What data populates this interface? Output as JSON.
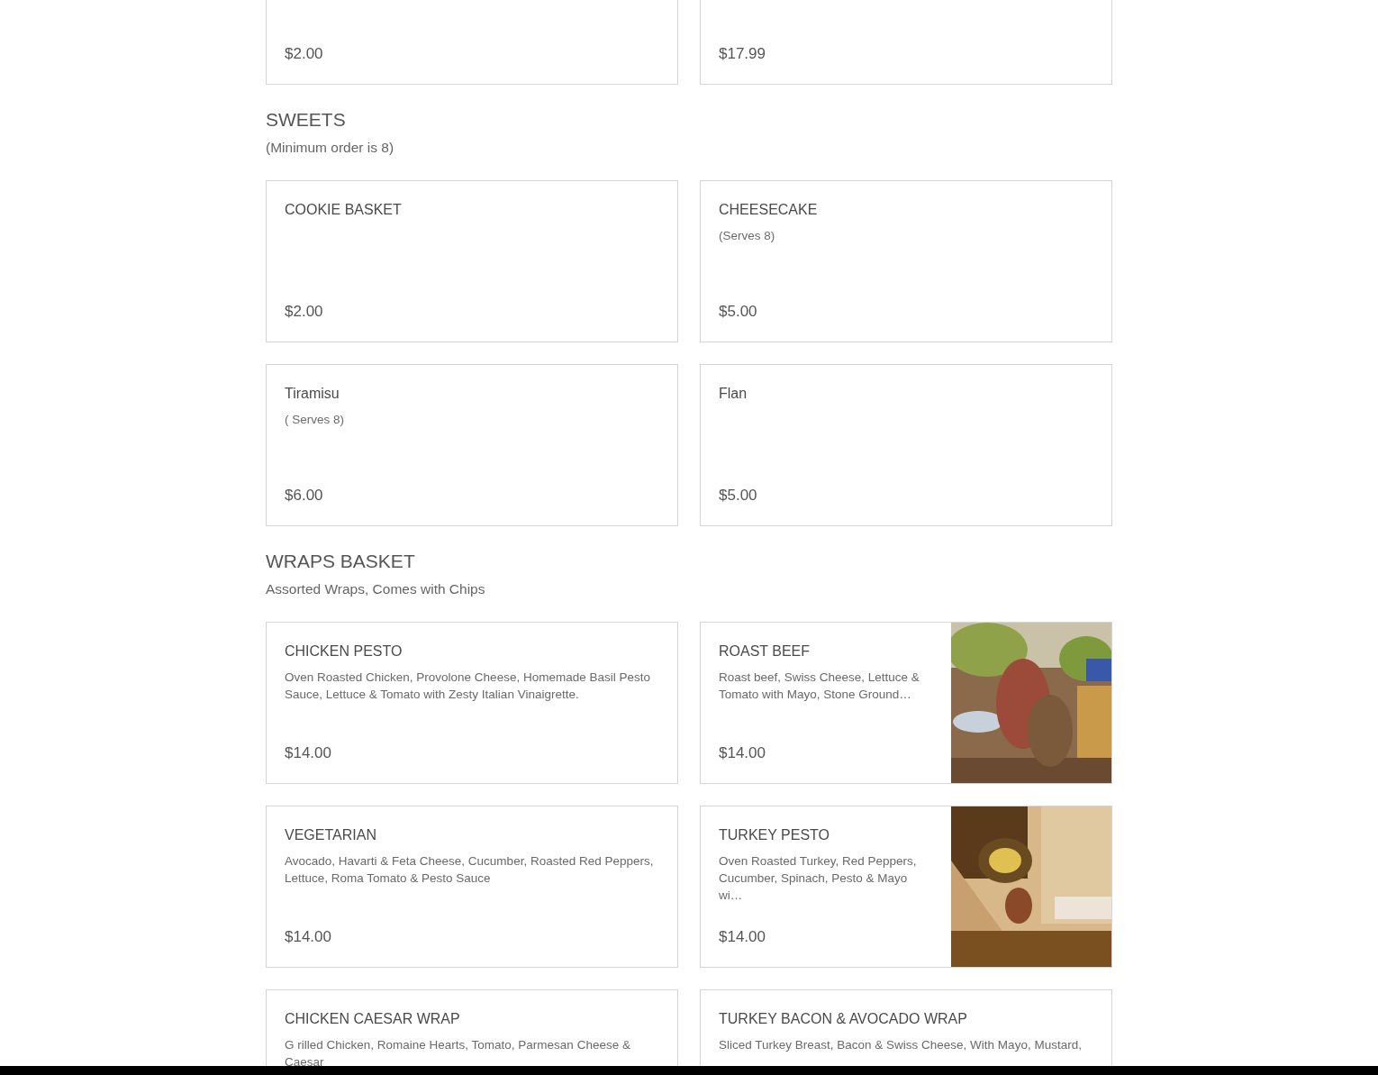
{
  "sections": [
    {
      "items": [
        {
          "price": "$2.00"
        },
        {
          "price": "$17.99"
        }
      ]
    },
    {
      "title": "SWEETS",
      "subtitle": "(Minimum order is 8)",
      "items": [
        {
          "name": "COOKIE BASKET",
          "price": "$2.00"
        },
        {
          "name": "CHEESECAKE",
          "description": "(Serves 8)",
          "price": "$5.00"
        },
        {
          "name": "Tiramisu",
          "description": "( Serves 8)",
          "price": "$6.00"
        },
        {
          "name": "Flan",
          "price": "$5.00"
        }
      ]
    },
    {
      "title": "WRAPS BASKET",
      "subtitle": "Assorted Wraps, Comes with Chips",
      "items": [
        {
          "name": "CHICKEN PESTO",
          "description": "Oven Roasted Chicken, Provolone Cheese, Homemade Basil Pesto Sauce, Lettuce & Tomato with Zesty Italian Vinaigrette.",
          "price": "$14.00"
        },
        {
          "name": "ROAST BEEF",
          "description": "Roast beef, Swiss Cheese, Lettuce & Tomato with Mayo, Stone Ground…",
          "price": "$14.00"
        },
        {
          "name": "VEGETARIAN",
          "description": "Avocado, Havarti & Feta Cheese, Cucumber, Roasted Red Peppers, Lettuce, Roma Tomato & Pesto Sauce",
          "price": "$14.00"
        },
        {
          "name": "TURKEY PESTO",
          "description": "Oven Roasted Turkey, Red Peppers, Cucumber, Spinach, Pesto & Mayo wi…",
          "price": "$14.00"
        },
        {
          "name": "CHICKEN CAESAR WRAP",
          "description": "G rilled Chicken, Romaine Hearts, Tomato, Parmesan Cheese & Caesar"
        },
        {
          "name": "TURKEY BACON & AVOCADO WRAP",
          "description": "Sliced Turkey Breast, Bacon & Swiss Cheese, With Mayo, Mustard,"
        }
      ]
    }
  ]
}
